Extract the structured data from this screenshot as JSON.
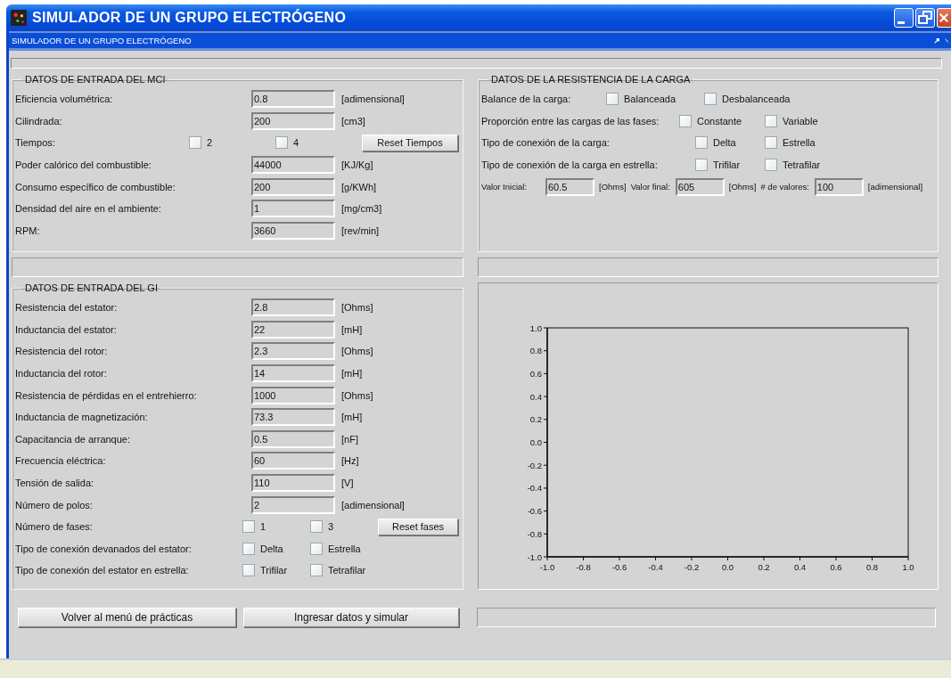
{
  "window": {
    "title": "SIMULADOR DE UN GRUPO ELECTRÓGENO"
  },
  "header": {
    "title": "SIMULADOR DE UN GRUPO ELECTRÓGENO"
  },
  "mci": {
    "title": "DATOS DE ENTRADA DEL MCI",
    "rows": [
      {
        "kind": "field",
        "label": "Eficiencia volumétrica:",
        "value": "0.8",
        "unit": "[adimensional]"
      },
      {
        "kind": "field",
        "label": "Cilindrada:",
        "value": "200",
        "unit": "[cm3]"
      },
      {
        "kind": "options",
        "label": "Tiempos:",
        "options": [
          {
            "label": "2",
            "checked": false
          },
          {
            "label": "4",
            "checked": false
          }
        ],
        "button": "Reset Tiempos"
      },
      {
        "kind": "field",
        "label": "Poder calórico del combustible:",
        "value": "44000",
        "unit": "[KJ/Kg]"
      },
      {
        "kind": "field",
        "label": "Consumo específico de combustible:",
        "value": "200",
        "unit": "[g/KWh]"
      },
      {
        "kind": "field",
        "label": "Densidad del aire en el ambiente:",
        "value": "1",
        "unit": "[mg/cm3]"
      },
      {
        "kind": "field",
        "label": "RPM:",
        "value": "3660",
        "unit": "[rev/min]"
      }
    ]
  },
  "carga": {
    "title": "DATOS DE LA RESISTENCIA DE LA CARGA",
    "rows": [
      {
        "kind": "options",
        "label": "Balance de la carga:",
        "options": [
          {
            "label": "Balanceada",
            "checked": false
          },
          {
            "label": "Desbalanceada",
            "checked": false
          }
        ]
      },
      {
        "kind": "options",
        "label": "Proporción entre las cargas de las fases:",
        "options": [
          {
            "label": "Constante",
            "checked": false
          },
          {
            "label": "Variable",
            "checked": false
          }
        ]
      },
      {
        "kind": "options",
        "label": "Tipo de conexión de la carga:",
        "options": [
          {
            "label": "Delta",
            "checked": false
          },
          {
            "label": "Estrella",
            "checked": false
          }
        ]
      },
      {
        "kind": "options",
        "label": "Tipo de conexión de la carga en estrella:",
        "options": [
          {
            "label": "Trifilar",
            "checked": false
          },
          {
            "label": "Tetrafilar",
            "checked": false
          }
        ]
      },
      {
        "kind": "values",
        "items": [
          {
            "label": "Valor Inicial:",
            "value": "60.5",
            "unit": "[Ohms]"
          },
          {
            "label": "Valor final:",
            "value": "605",
            "unit": "[Ohms]"
          },
          {
            "label": "# de valores:",
            "value": "100",
            "unit": "[adimensional]"
          }
        ]
      }
    ]
  },
  "gi": {
    "title": "DATOS DE ENTRADA DEL GI",
    "rows": [
      {
        "kind": "field",
        "label": "Resistencia del estator:",
        "value": "2.8",
        "unit": "[Ohms]"
      },
      {
        "kind": "field",
        "label": "Inductancia del estator:",
        "value": "22",
        "unit": "[mH]"
      },
      {
        "kind": "field",
        "label": "Resistencia del rotor:",
        "value": "2.3",
        "unit": "[Ohms]"
      },
      {
        "kind": "field",
        "label": "Inductancia del rotor:",
        "value": "14",
        "unit": "[mH]"
      },
      {
        "kind": "field",
        "label": "Resistencia de pérdidas en el entrehierro:",
        "value": "1000",
        "unit": "[Ohms]"
      },
      {
        "kind": "field",
        "label": "Inductancia de magnetización:",
        "value": "73.3",
        "unit": "[mH]"
      },
      {
        "kind": "field",
        "label": "Capacitancia de arranque:",
        "value": "0.5",
        "unit": "[nF]"
      },
      {
        "kind": "field",
        "label": "Frecuencia eléctrica:",
        "value": "60",
        "unit": "[Hz]"
      },
      {
        "kind": "field",
        "label": "Tensión de salida:",
        "value": "110",
        "unit": "[V]"
      },
      {
        "kind": "field",
        "label": "Número de polos:",
        "value": "2",
        "unit": "[adimensional]"
      },
      {
        "kind": "options",
        "label": "Número de fases:",
        "options": [
          {
            "label": "1",
            "checked": false
          },
          {
            "label": "3",
            "checked": false
          }
        ],
        "button": "Reset fases"
      },
      {
        "kind": "options",
        "label": "Tipo de conexión devanados del estator:",
        "options": [
          {
            "label": "Delta",
            "checked": false
          },
          {
            "label": "Estrella",
            "checked": false
          }
        ]
      },
      {
        "kind": "options",
        "label": "Tipo de conexión del estator en estrella:",
        "options": [
          {
            "label": "Trifilar",
            "checked": false
          },
          {
            "label": "Tetrafilar",
            "checked": false
          }
        ]
      }
    ]
  },
  "chart": {
    "chart_data": {
      "type": "line",
      "xlim": [
        -1,
        1
      ],
      "ylim": [
        -1,
        1
      ],
      "xticks": [
        {
          "value": -1,
          "label": "-1.0"
        },
        {
          "value": -0.8,
          "label": "-0.8"
        },
        {
          "value": -0.6,
          "label": "-0.6"
        },
        {
          "value": -0.4,
          "label": "-0.4"
        },
        {
          "value": -0.2,
          "label": "-0.2"
        },
        {
          "value": 0,
          "label": "0.0"
        },
        {
          "value": 0.2,
          "label": "0.2"
        },
        {
          "value": 0.4,
          "label": "0.4"
        },
        {
          "value": 0.6,
          "label": "0.6"
        },
        {
          "value": 0.8,
          "label": "0.8"
        },
        {
          "value": 1,
          "label": "1.0"
        }
      ],
      "yticks": [
        {
          "value": 1,
          "label": "1.0"
        },
        {
          "value": 0.8,
          "label": "0.8"
        },
        {
          "value": 0.6,
          "label": "0.6"
        },
        {
          "value": 0.4,
          "label": "0.4"
        },
        {
          "value": 0.2,
          "label": "0.2"
        },
        {
          "value": 0,
          "label": "0.0"
        },
        {
          "value": -0.2,
          "label": "-0.2"
        },
        {
          "value": -0.4,
          "label": "-0.4"
        },
        {
          "value": -0.6,
          "label": "-0.6"
        },
        {
          "value": -0.8,
          "label": "-0.8"
        },
        {
          "value": -1,
          "label": "-1.0"
        }
      ]
    }
  },
  "buttons": [
    "Volver al menú de prácticas",
    "Ingresar datos y simular"
  ]
}
